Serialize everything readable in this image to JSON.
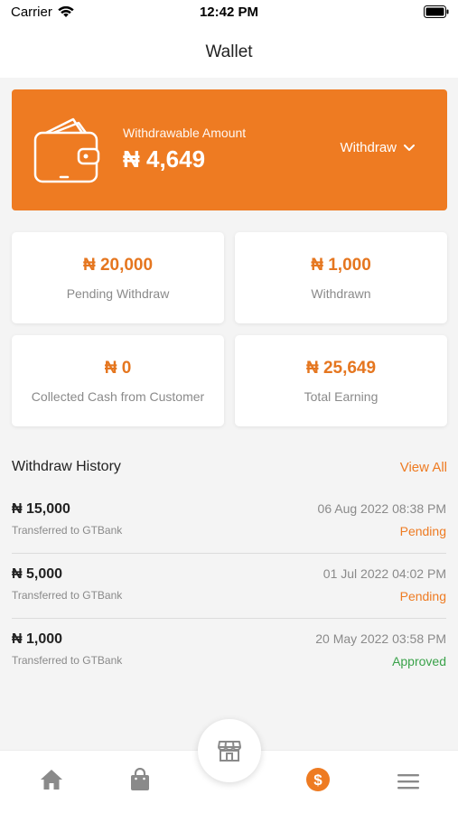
{
  "status_bar": {
    "carrier": "Carrier",
    "time": "12:42 PM"
  },
  "nav": {
    "title": "Wallet"
  },
  "wallet": {
    "label": "Withdrawable Amount",
    "amount": "₦ 4,649",
    "withdraw_label": "Withdraw"
  },
  "stats": [
    {
      "value": "₦ 20,000",
      "label": "Pending Withdraw"
    },
    {
      "value": "₦ 1,000",
      "label": "Withdrawn"
    },
    {
      "value": "₦ 0",
      "label": "Collected Cash from Customer"
    },
    {
      "value": "₦ 25,649",
      "label": "Total Earning"
    }
  ],
  "history": {
    "title": "Withdraw History",
    "view_all": "View All",
    "rows": [
      {
        "amount": "₦ 15,000",
        "bank": "Transferred to GTBank",
        "date": "06 Aug 2022  08:38 PM",
        "status": "Pending"
      },
      {
        "amount": "₦ 5,000",
        "bank": "Transferred to GTBank",
        "date": "01 Jul 2022  04:02 PM",
        "status": "Pending"
      },
      {
        "amount": "₦ 1,000",
        "bank": "Transferred to GTBank",
        "date": "20 May 2022  03:58 PM",
        "status": "Approved"
      }
    ]
  },
  "colors": {
    "accent": "#ee7b22",
    "pending": "#ee7b22",
    "approved": "#3aa24a",
    "tab_inactive": "#8a8a8a"
  },
  "tabs": [
    "home-icon",
    "shopping-bag-icon",
    "store-icon",
    "dollar-icon",
    "menu-icon"
  ]
}
